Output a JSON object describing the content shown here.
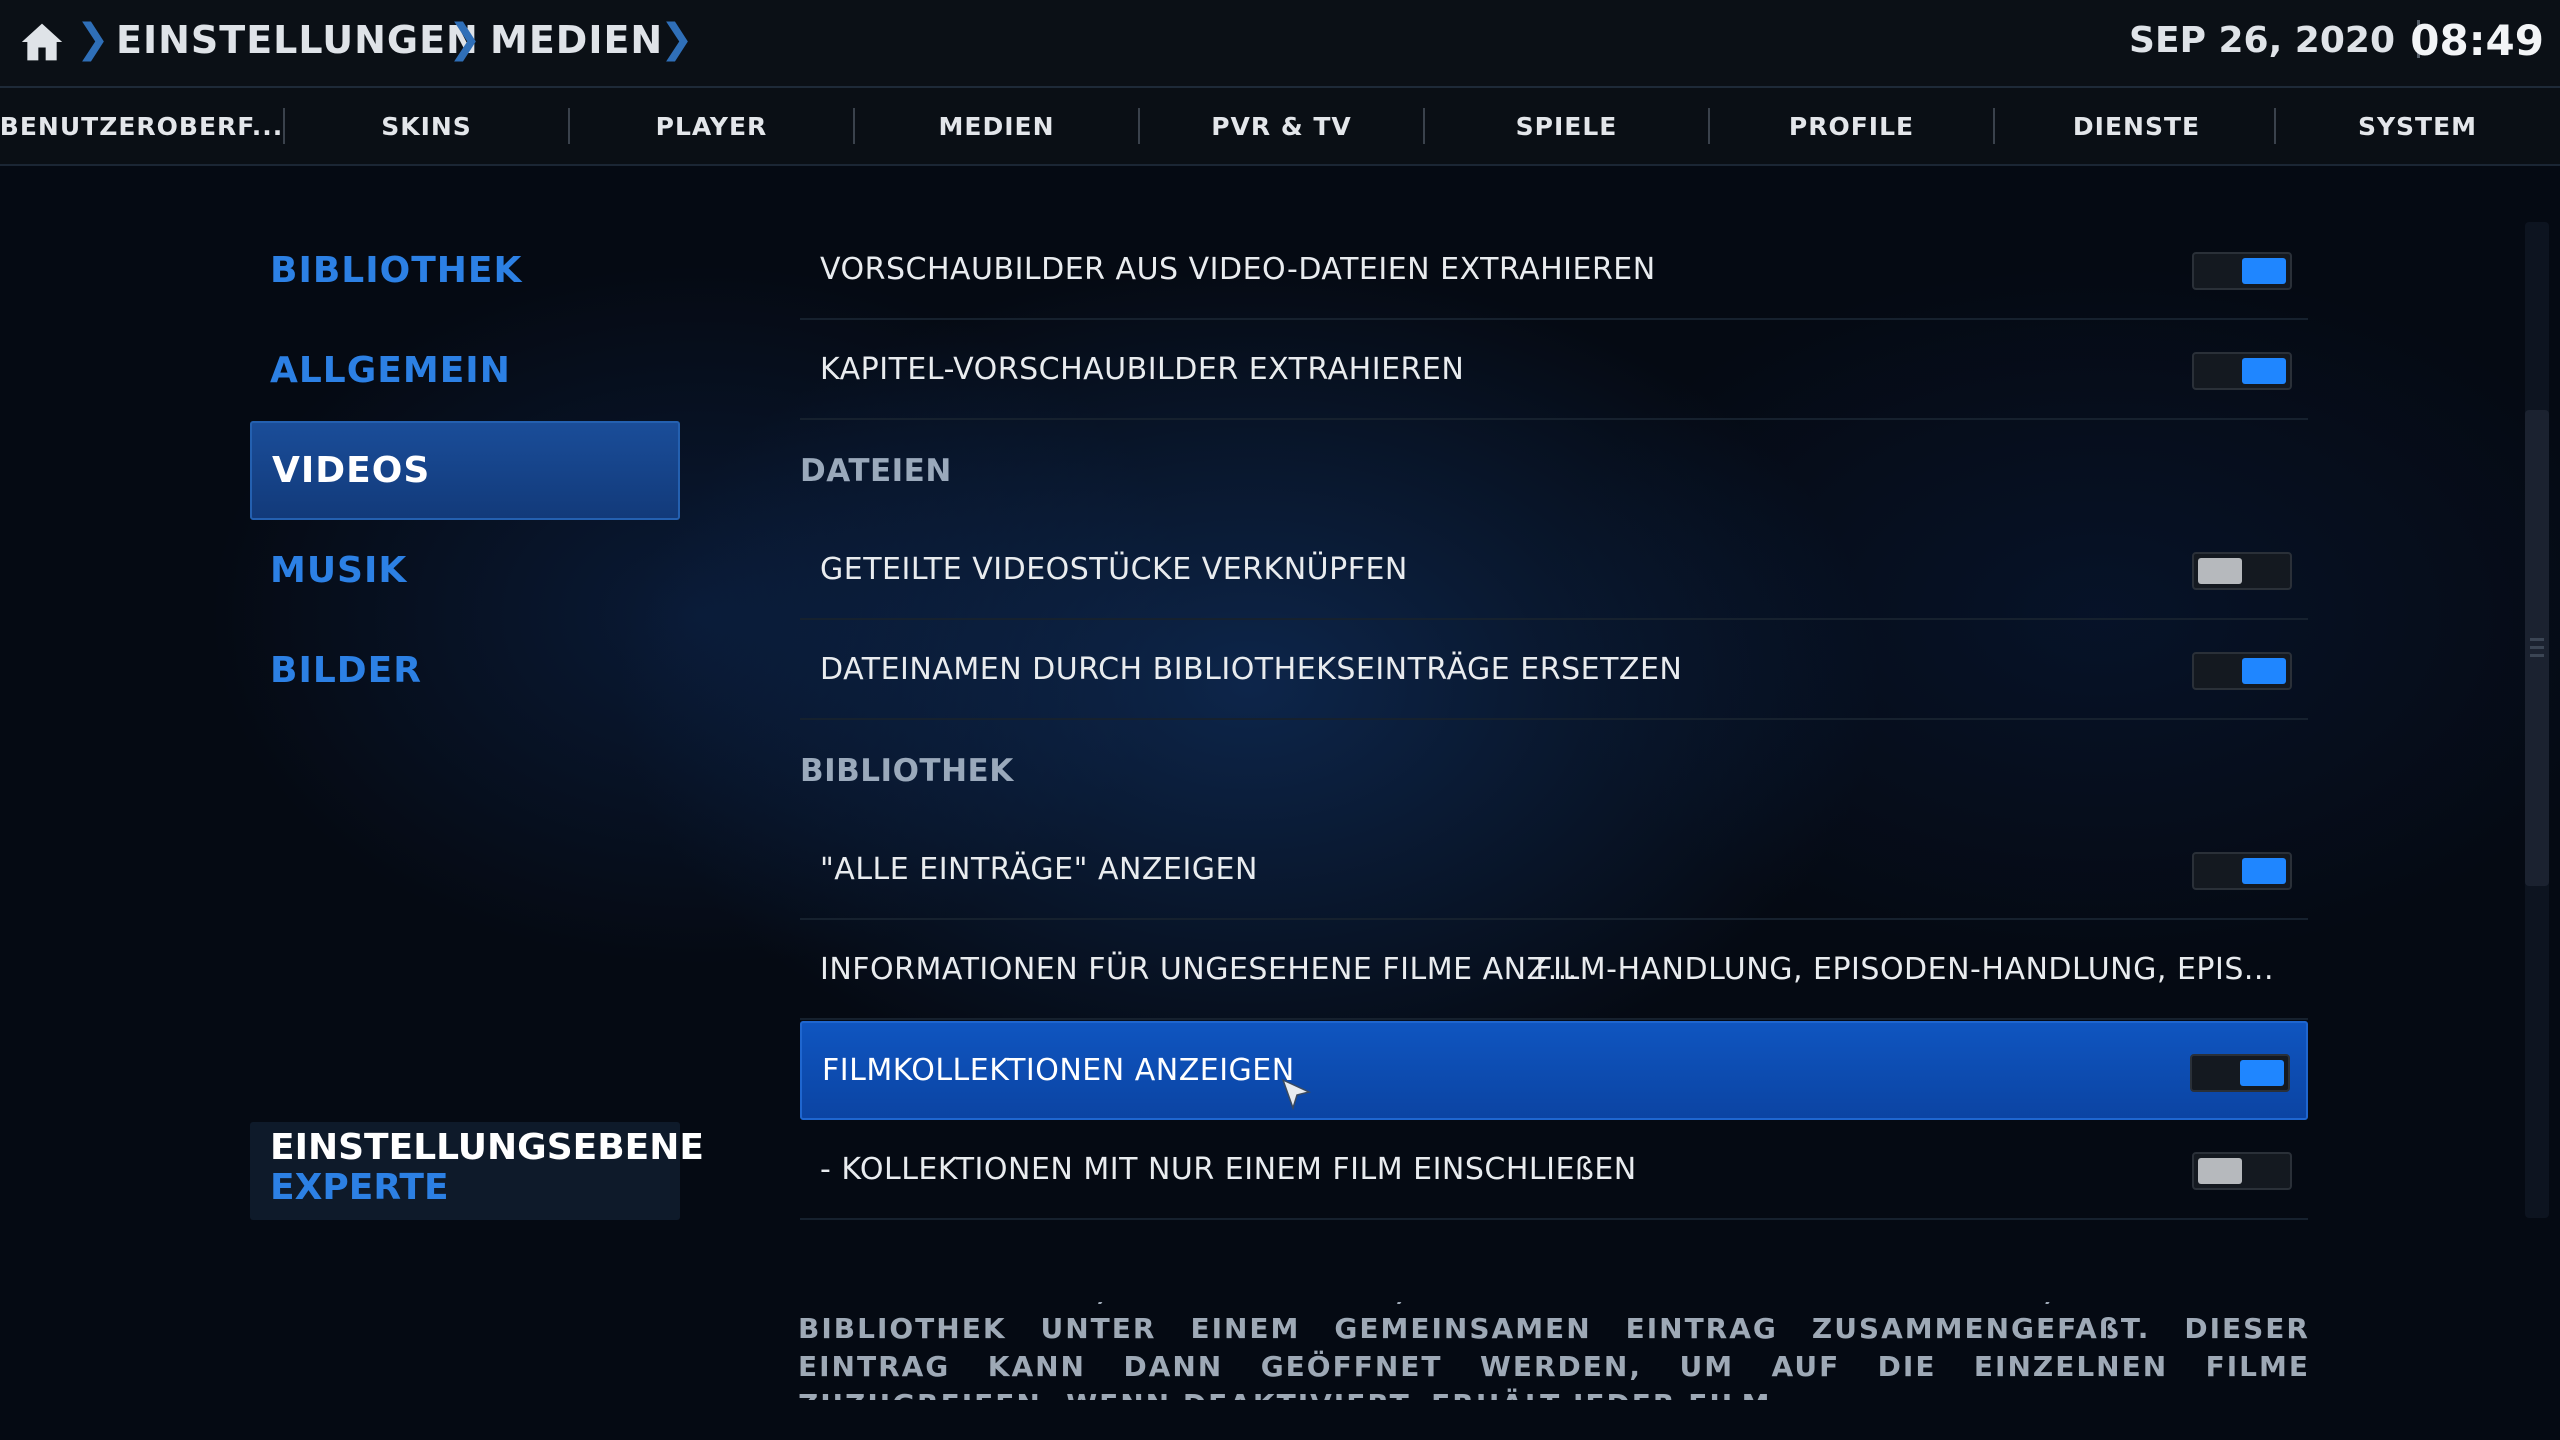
{
  "breadcrumb": [
    "EINSTELLUNGEN",
    "MEDIEN"
  ],
  "datetime": {
    "date": "SEP 26, 2020",
    "time": "08:49"
  },
  "tabs": [
    "BENUTZEROBERF...",
    "SKINS",
    "PLAYER",
    "MEDIEN",
    "PVR & TV",
    "SPIELE",
    "PROFILE",
    "DIENSTE",
    "SYSTEM"
  ],
  "categories": [
    {
      "label": "BIBLIOTHEK",
      "active": false
    },
    {
      "label": "ALLGEMEIN",
      "active": false
    },
    {
      "label": "VIDEOS",
      "active": true
    },
    {
      "label": "MUSIK",
      "active": false
    },
    {
      "label": "BILDER",
      "active": false
    }
  ],
  "settings_level": {
    "title": "EINSTELLUNGSEBENE",
    "value": "EXPERTE"
  },
  "settings": [
    {
      "type": "toggle",
      "label": "VORSCHAUBILDER AUS VIDEO-DATEIEN EXTRAHIEREN",
      "state": "on"
    },
    {
      "type": "toggle",
      "label": "KAPITEL-VORSCHAUBILDER EXTRAHIEREN",
      "state": "on"
    },
    {
      "type": "header",
      "label": "DATEIEN"
    },
    {
      "type": "toggle",
      "label": "GETEILTE VIDEOSTÜCKE VERKNÜPFEN",
      "state": "off"
    },
    {
      "type": "toggle",
      "label": "DATEINAMEN DURCH BIBLIOTHEKSEINTRÄGE ERSETZEN",
      "state": "on"
    },
    {
      "type": "header",
      "label": "BIBLIOTHEK"
    },
    {
      "type": "toggle",
      "label": "\"ALLE EINTRÄGE\" ANZEIGEN",
      "state": "on"
    },
    {
      "type": "value",
      "label": "INFORMATIONEN FÜR UNGESEHENE FILME ANZ...",
      "value": "FILM-HANDLUNG, EPISODEN-HANDLUNG, EPIS..."
    },
    {
      "type": "toggle",
      "label": "FILMKOLLEKTIONEN ANZEIGEN",
      "state": "on",
      "focused": true
    },
    {
      "type": "toggle",
      "label": "- KOLLEKTIONEN MIT NUR EINEM FILM EINSCHLIEßEN",
      "state": "off"
    }
  ],
  "description": "WENN AKTIVIERT, WERDEN FILME, DIE ZU \"KOLLEKTIONEN\" GEHÖREN, IN DER FILM-BIBLIOTHEK UNTER EINEM GEMEINSAMEN EINTRAG ZUSAMMENGEFAßT. DIESER EINTRAG KANN DANN GEÖFFNET WERDEN, UM AUF DIE EINZELNEN FILME ZUZUGREIFEN. WENN DEAKTIVIERT, ERHÄLT JEDER FILM"
}
